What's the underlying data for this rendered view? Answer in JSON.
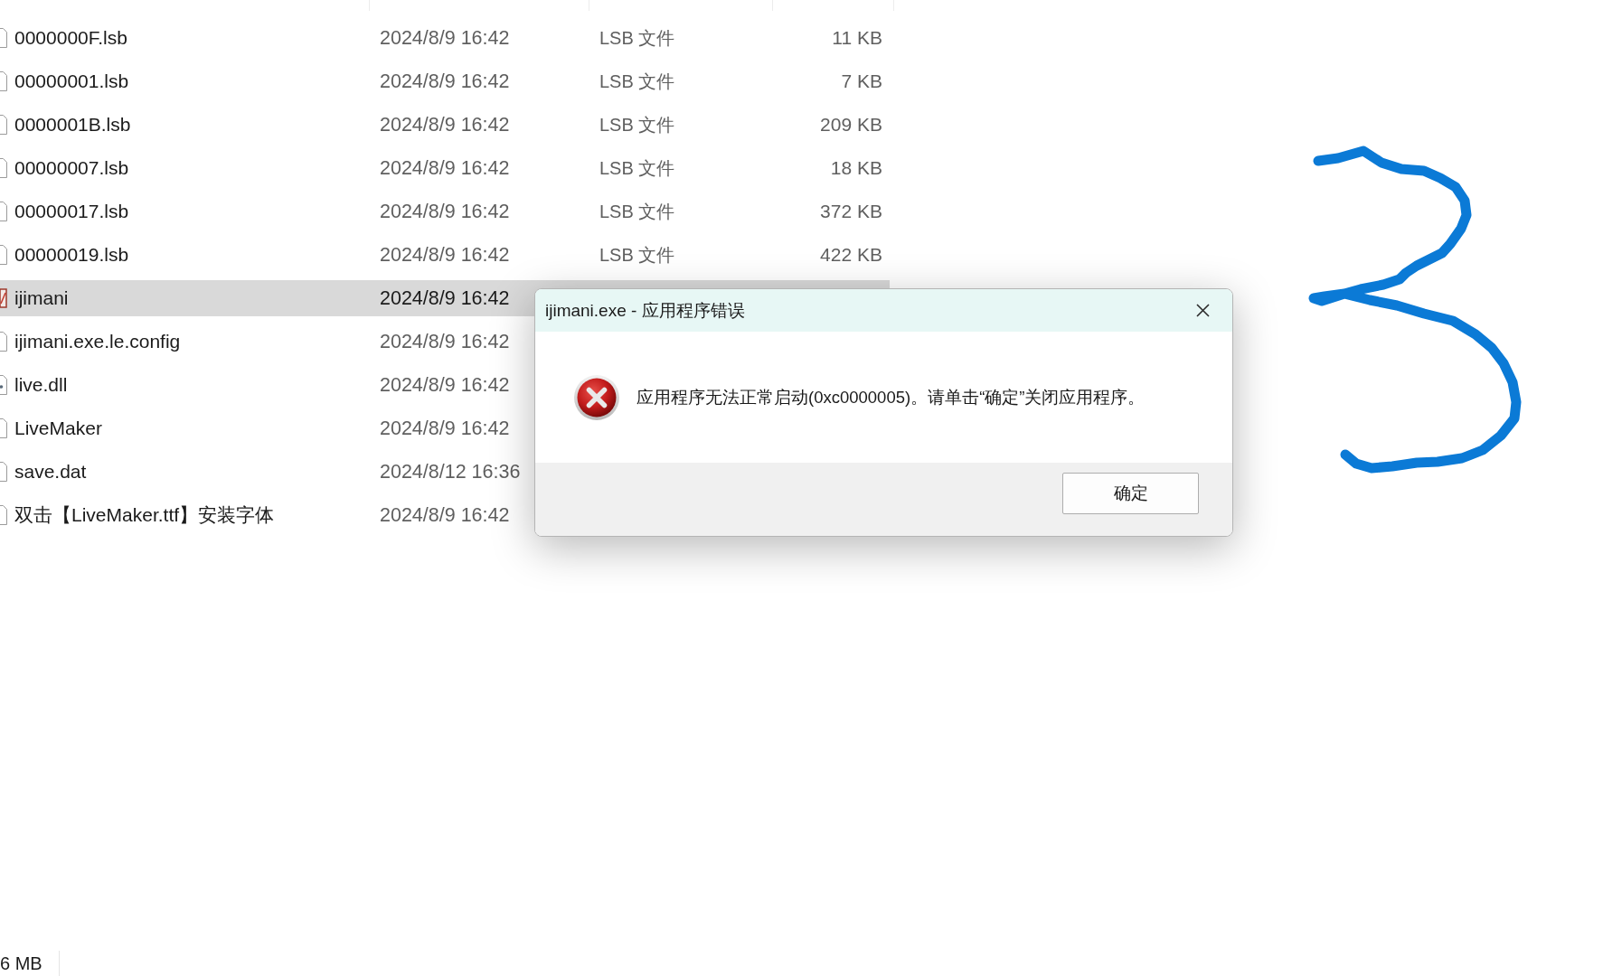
{
  "file_list": {
    "rows": [
      {
        "kind": "file",
        "name": "0000000F.lsb",
        "modified": "2024/8/9 16:42",
        "type": "LSB 文件",
        "size": "11 KB",
        "selected": false
      },
      {
        "kind": "file",
        "name": "00000001.lsb",
        "modified": "2024/8/9 16:42",
        "type": "LSB 文件",
        "size": "7 KB",
        "selected": false
      },
      {
        "kind": "file",
        "name": "0000001B.lsb",
        "modified": "2024/8/9 16:42",
        "type": "LSB 文件",
        "size": "209 KB",
        "selected": false
      },
      {
        "kind": "file",
        "name": "00000007.lsb",
        "modified": "2024/8/9 16:42",
        "type": "LSB 文件",
        "size": "18 KB",
        "selected": false
      },
      {
        "kind": "file",
        "name": "00000017.lsb",
        "modified": "2024/8/9 16:42",
        "type": "LSB 文件",
        "size": "372 KB",
        "selected": false
      },
      {
        "kind": "file",
        "name": "00000019.lsb",
        "modified": "2024/8/9 16:42",
        "type": "LSB 文件",
        "size": "422 KB",
        "selected": false
      },
      {
        "kind": "app",
        "name": "ijimani",
        "modified": "2024/8/9 16:42",
        "selected": true
      },
      {
        "kind": "file",
        "name": "ijimani.exe.le.config",
        "modified": "2024/8/9 16:42",
        "selected": false
      },
      {
        "kind": "library",
        "name": "live.dll",
        "modified": "2024/8/9 16:42",
        "selected": false
      },
      {
        "kind": "file",
        "name": "LiveMaker",
        "modified": "2024/8/9 16:42",
        "selected": false
      },
      {
        "kind": "file",
        "name": "save.dat",
        "modified": "2024/8/12 16:36",
        "selected": false
      },
      {
        "kind": "file",
        "name": "双击【LiveMaker.ttf】安装字体",
        "modified": "2024/8/9 16:42",
        "selected": false
      }
    ]
  },
  "error_dialog": {
    "title": "ijimani.exe - 应用程序错误",
    "message": "应用程序无法正常启动(0xc0000005)。请单击“确定”关闭应用程序。",
    "buttons": [
      "确定"
    ]
  },
  "status_bar": {
    "size": "6 MB"
  }
}
